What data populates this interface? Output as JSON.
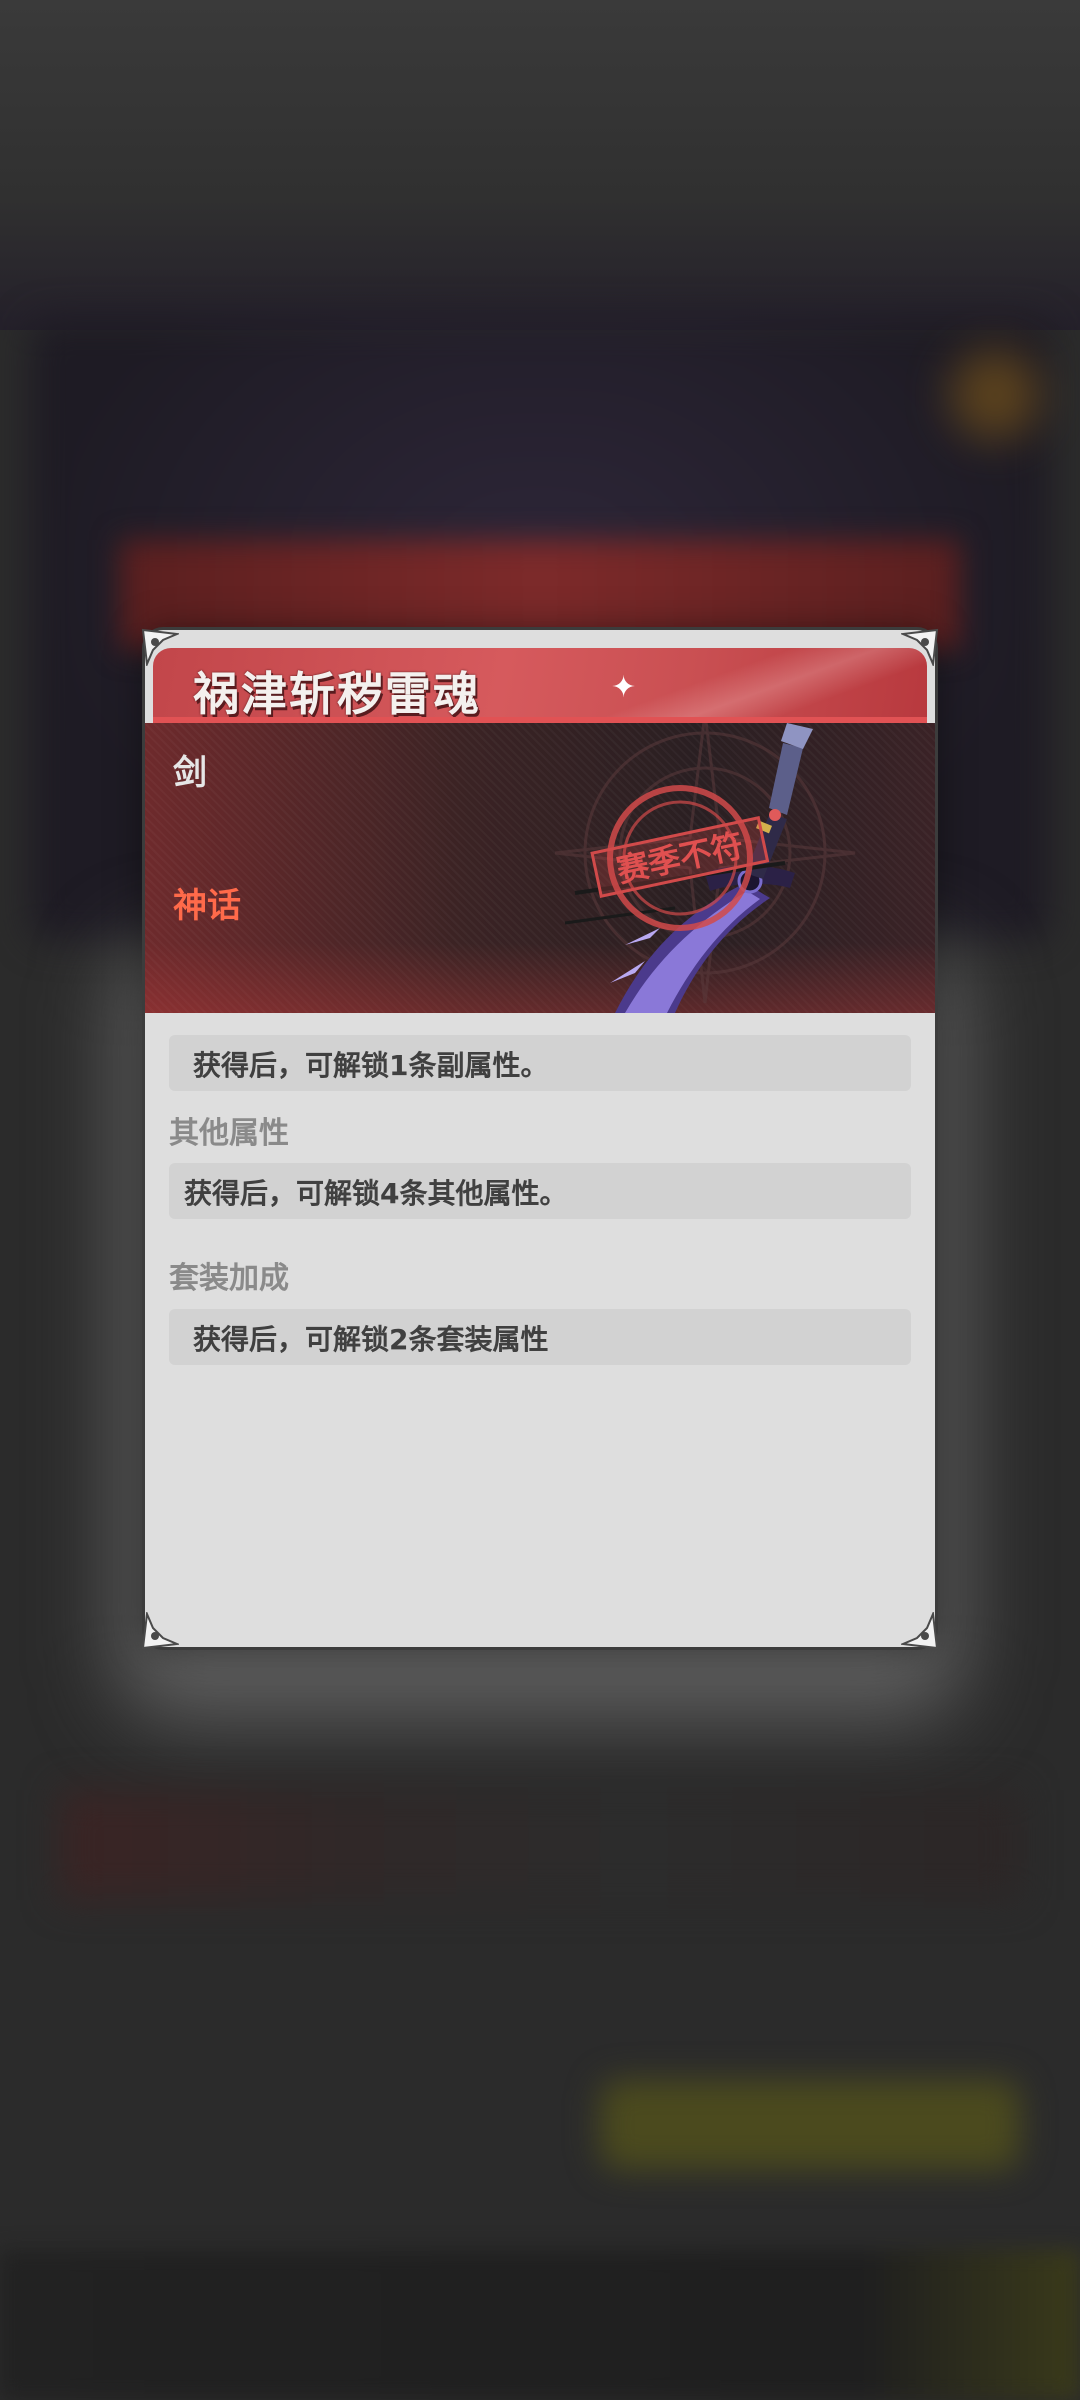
{
  "item": {
    "title": "祸津斩秽雷魂",
    "type": "剑",
    "rarity": "神话",
    "stamp_text": "赛季不符"
  },
  "sections": {
    "sub_attribute_text": "获得后，可解锁1条副属性。",
    "other_attributes_heading": "其他属性",
    "other_attributes_text": "获得后，可解锁4条其他属性。",
    "set_bonus_heading": "套装加成",
    "set_bonus_text": "获得后，可解锁2条套装属性"
  },
  "colors": {
    "header_red": "#c94f52",
    "rarity_orange": "#ff6a4a",
    "card_bg": "#dedede"
  },
  "icons": [
    "sparkle-icon",
    "corner-ornament-icon",
    "weapon-sword-icon",
    "season-stamp-icon"
  ]
}
